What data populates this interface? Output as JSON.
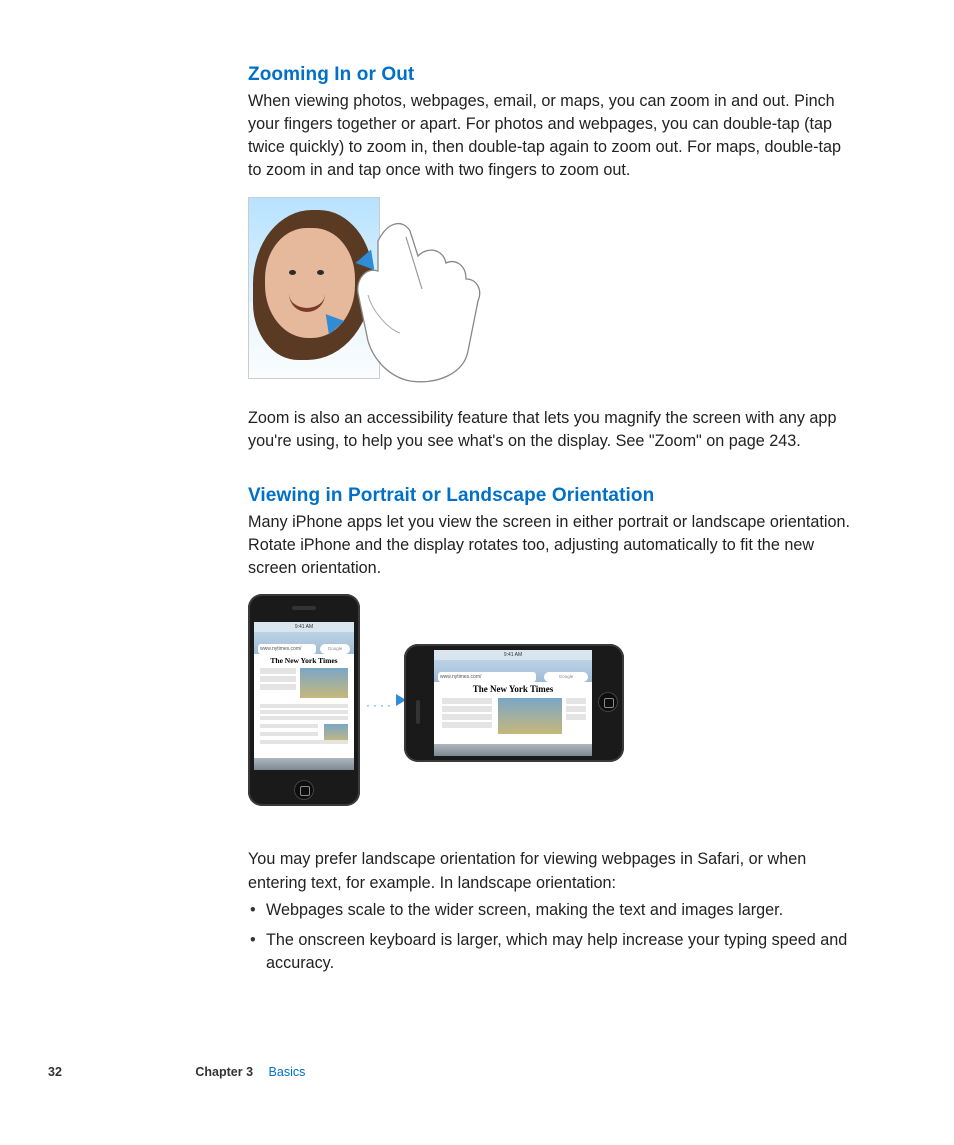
{
  "sections": {
    "zoom": {
      "heading": "Zooming In or Out",
      "p1": "When viewing photos, webpages, email, or maps, you can zoom in and out. Pinch your fingers together or apart. For photos and webpages, you can double-tap (tap twice quickly) to zoom in, then double-tap again to zoom out. For maps, double-tap to zoom in and tap once with two fingers to zoom out.",
      "p2": "Zoom is also an accessibility feature that lets you magnify the screen with any app you're using, to help you see what's on the display. See \"Zoom\" on page 243."
    },
    "orient": {
      "heading": "Viewing in Portrait or Landscape Orientation",
      "p1": "Many iPhone apps let you view the screen in either portrait or landscape orientation. Rotate iPhone and the display rotates too, adjusting automatically to fit the new screen orientation.",
      "p2": "You may prefer landscape orientation for viewing webpages in Safari, or when entering text, for example. In landscape orientation:",
      "bullets": [
        "Webpages scale to the wider screen, making the text and images larger.",
        "The onscreen keyboard is larger, which may help increase your typing speed and accuracy."
      ]
    }
  },
  "figures": {
    "phone": {
      "time": "9:41 AM",
      "url": "www.nytimes.com/",
      "search_placeholder": "Google",
      "masthead": "The New York Times"
    }
  },
  "footer": {
    "page": "32",
    "chapter_label": "Chapter 3",
    "chapter_name": "Basics"
  }
}
